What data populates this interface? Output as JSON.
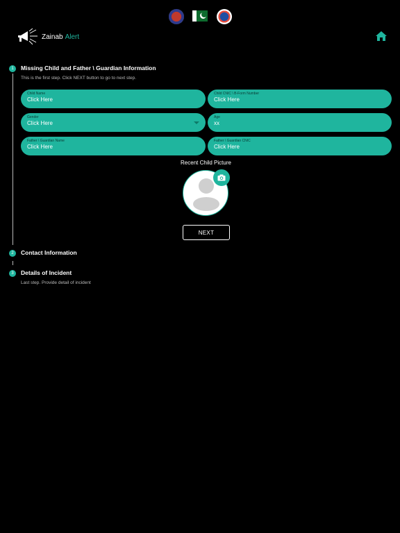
{
  "header": {
    "brand_name_1": "Zainab",
    "brand_name_2": "Alert"
  },
  "steps": [
    {
      "number": "1",
      "title": "Missing Child and Father \\ Guardian Information",
      "subtitle": "This is the first step. Click NEXT button to go to next step."
    },
    {
      "number": "2",
      "title": "Contact Information"
    },
    {
      "number": "3",
      "title": "Details of Incident",
      "subtitle": "Last step. Provide detail of incident"
    }
  ],
  "form": {
    "child_name": {
      "label": "Child Name",
      "value": "Click Here"
    },
    "child_cnic": {
      "label": "Child CNIC \\ B-Form Number",
      "value": "Click Here"
    },
    "gender": {
      "label": "Gender",
      "value": "Click Here"
    },
    "age": {
      "label": "Age",
      "value": "xx"
    },
    "guardian_name": {
      "label": "Father \\ Guardian Name",
      "value": "Click Here"
    },
    "guardian_cnic": {
      "label": "Father \\ Guardian CNIC",
      "value": "Click Here"
    }
  },
  "picture": {
    "label": "Recent Child Picture"
  },
  "next_label": "NEXT",
  "colors": {
    "accent": "#1fb59e",
    "background": "#000000"
  }
}
